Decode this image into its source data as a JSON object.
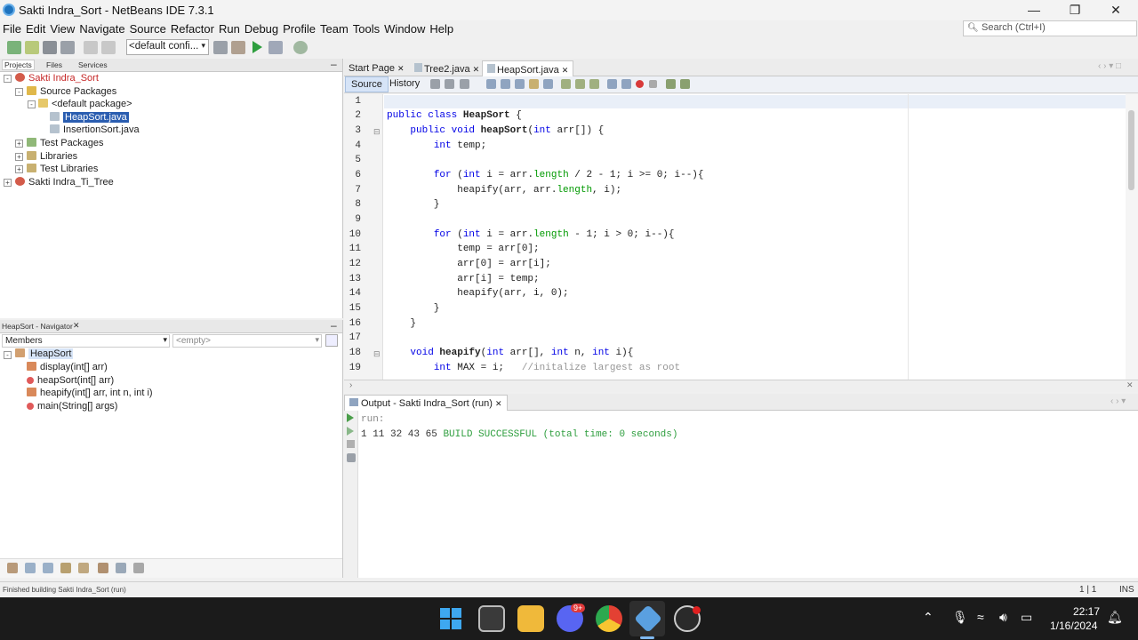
{
  "window": {
    "title": "Sakti Indra_Sort - NetBeans IDE 7.3.1",
    "minimize": "—",
    "maximize": "❐",
    "close": "✕"
  },
  "menu": [
    "File",
    "Edit",
    "View",
    "Navigate",
    "Source",
    "Refactor",
    "Run",
    "Debug",
    "Profile",
    "Team",
    "Tools",
    "Window",
    "Help"
  ],
  "search": {
    "placeholder": "Search (Ctrl+I)"
  },
  "toolbar": {
    "config": "<default confi..."
  },
  "projects_panel": {
    "tabs": [
      "Projects",
      "Files",
      "Services"
    ],
    "tree": {
      "project": "Sakti Indra_Sort",
      "source_packages": "Source Packages",
      "default_package": "<default package>",
      "files": [
        "HeapSort.java",
        "InsertionSort.java"
      ],
      "test_packages": "Test Packages",
      "libraries": "Libraries",
      "test_libraries": "Test Libraries",
      "other_project": "Sakti Indra_Ti_Tree"
    }
  },
  "navigator_panel": {
    "tab": "HeapSort - Navigator",
    "members_combo": "Members",
    "filter_combo": "<empty>",
    "class_name": "HeapSort",
    "members": [
      "display(int[] arr)",
      "heapSort(int[] arr)",
      "heapify(int[] arr, int n, int i)",
      "main(String[] args)"
    ]
  },
  "editor": {
    "tabs": [
      "Start Page",
      "Tree2.java",
      "HeapSort.java"
    ],
    "source_button": "Source",
    "history_button": "History",
    "line_numbers": [
      "1",
      "2",
      "3",
      "4",
      "5",
      "6",
      "7",
      "8",
      "9",
      "10",
      "11",
      "12",
      "13",
      "14",
      "15",
      "16",
      "17",
      "18",
      "19"
    ],
    "code_lines": [
      "",
      "public class HeapSort {",
      "    public void heapSort(int arr[]) {",
      "        int temp;",
      "",
      "        for (int i = arr.length / 2 - 1; i >= 0; i--){",
      "            heapify(arr, arr.length, i);",
      "        }",
      "",
      "        for (int i = arr.length - 1; i > 0; i--){",
      "            temp = arr[0];",
      "            arr[0] = arr[i];",
      "            arr[i] = temp;",
      "            heapify(arr, i, 0);",
      "        }",
      "    }",
      "",
      "    void heapify(int arr[], int n, int i){",
      "        int MAX = i;   //initalize largest as root"
    ]
  },
  "output": {
    "tab": "Output - Sakti Indra_Sort (run)",
    "run_line": "run:",
    "result_numbers": "1 11 32 43 65",
    "build_message": "BUILD SUCCESSFUL (total time: 0 seconds)"
  },
  "status": {
    "message": "Finished building Sakti Indra_Sort (run)",
    "position": "1 | 1",
    "mode": "INS"
  },
  "taskbar": {
    "time": "22:17",
    "date": "1/16/2024",
    "discord_badge": "9+"
  }
}
